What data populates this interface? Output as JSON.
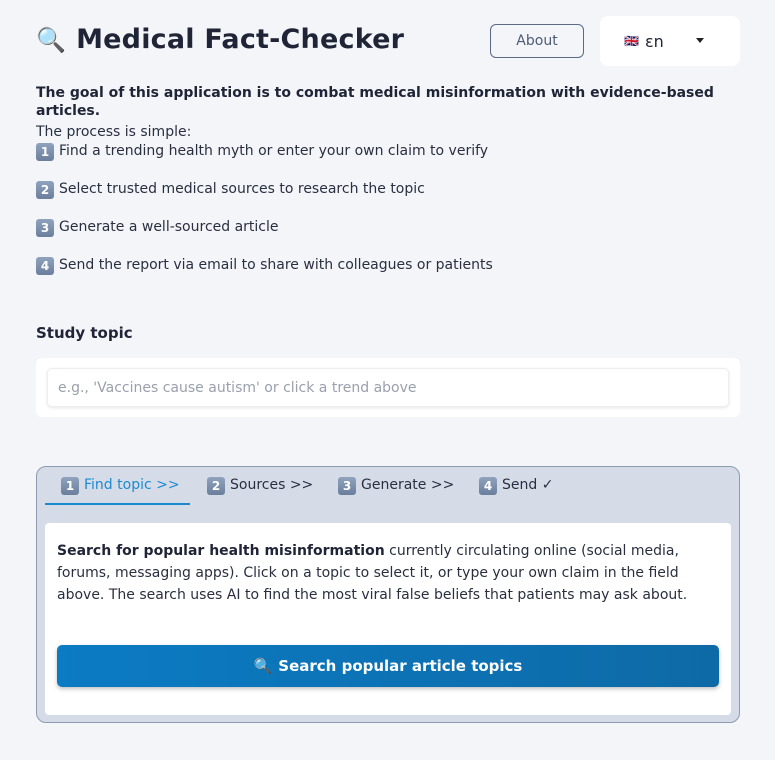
{
  "header": {
    "title_icon": "🔍",
    "title": "Medical Fact-Checker",
    "about_label": "About",
    "language": {
      "flag": "🇬🇧",
      "selected": "εn"
    }
  },
  "intro": {
    "goal": "The goal of this application is to combat medical misinformation with evidence-based articles.",
    "process": "The process is simple:",
    "steps": [
      {
        "num": "1",
        "text": "Find a trending health myth or enter your own claim to verify"
      },
      {
        "num": "2",
        "text": "Select trusted medical sources to research the topic"
      },
      {
        "num": "3",
        "text": "Generate a well-sourced article"
      },
      {
        "num": "4",
        "text": "Send the report via email to share with colleagues or patients"
      }
    ]
  },
  "study_topic": {
    "label": "Study topic",
    "placeholder": "e.g., 'Vaccines cause autism' or click a trend above",
    "value": ""
  },
  "tabs": [
    {
      "num": "1",
      "label": "Find topic >>",
      "active": true
    },
    {
      "num": "2",
      "label": "Sources >>",
      "active": false
    },
    {
      "num": "3",
      "label": "Generate >>",
      "active": false
    },
    {
      "num": "4",
      "label": "Send ✓",
      "active": false
    }
  ],
  "find_topic": {
    "description_bold": "Search for popular health misinformation",
    "description_rest": " currently circulating online (social media, forums, messaging apps). Click on a topic to select it, or type your own claim in the field above. The search uses AI to find the most viral false beliefs that patients may ask about.",
    "search_icon": "🔍",
    "search_label": "Search popular article topics"
  },
  "colors": {
    "accent": "#1c8ad0",
    "button": "#0b7bc4",
    "panel_bg": "#d5dce8",
    "page_bg": "#f3f5f9"
  }
}
